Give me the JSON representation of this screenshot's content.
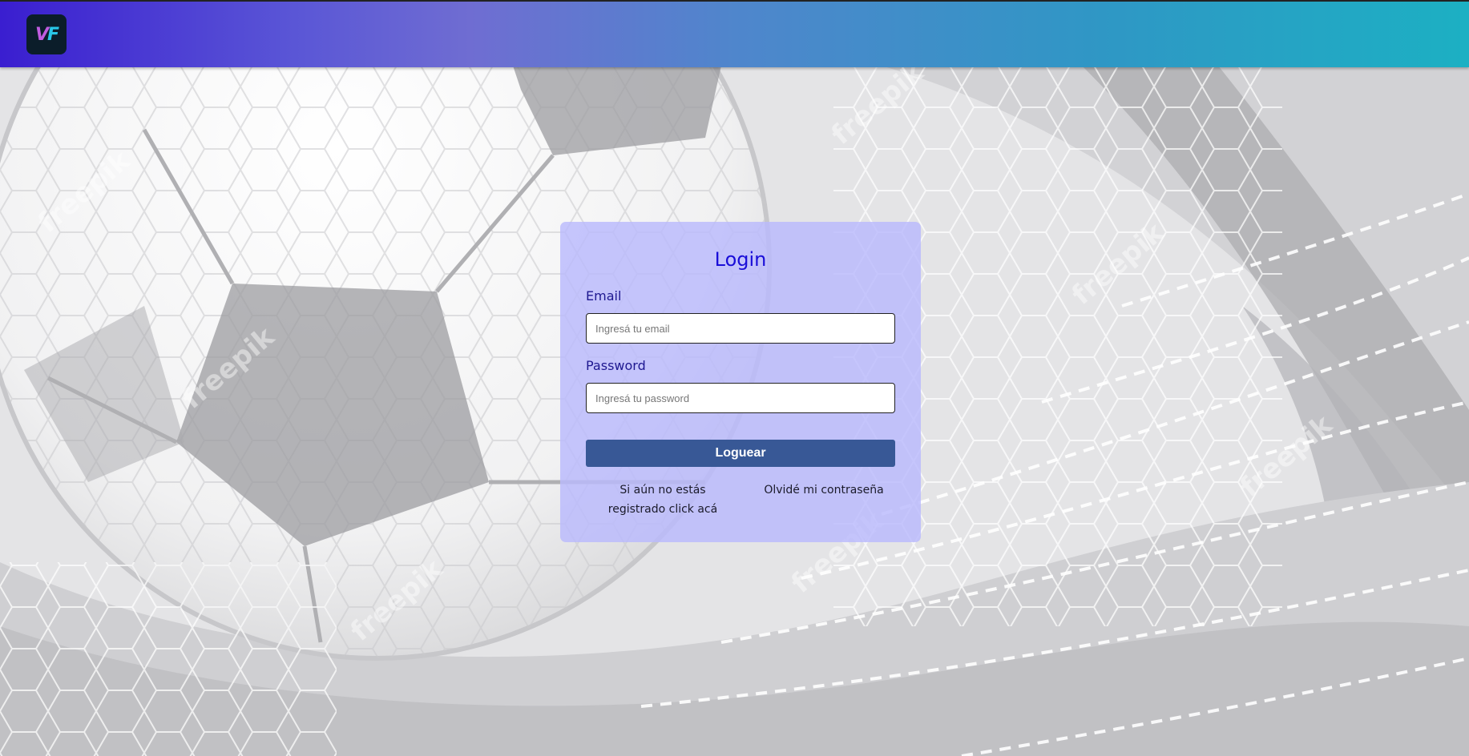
{
  "brand": {
    "logo_text_v": "V",
    "logo_text_f": "F",
    "colors": {
      "bar_start": "#3a1ed0",
      "bar_mid": "#6f6dd2",
      "bar_end": "#1cb0c3",
      "logo_bg": "#0b1d2a",
      "logo_v": "#c05ce0",
      "logo_f": "#28c6e8"
    }
  },
  "background": {
    "watermark": "freepik",
    "illustration": "soccer-ball-and-net"
  },
  "login": {
    "title": "Login",
    "email_label": "Email",
    "email_placeholder": "Ingresá tu email",
    "email_value": "",
    "password_label": "Password",
    "password_placeholder": "Ingresá tu password",
    "password_value": "",
    "submit_label": "Loguear",
    "register_link": "Si aún no estás registrado click acá",
    "forgot_link": "Olvidé mi contraseña",
    "colors": {
      "card_bg": "#b9b9fc",
      "title": "#1a0ed8",
      "label": "#1e1890",
      "button_bg": "#385896",
      "button_text": "#ffffff"
    }
  }
}
